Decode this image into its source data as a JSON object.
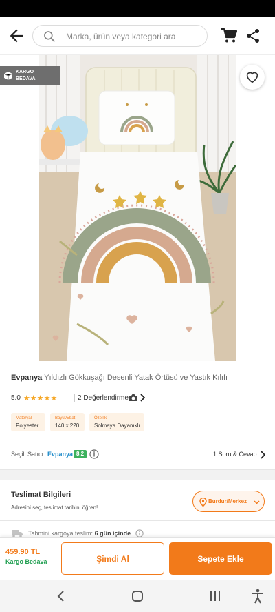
{
  "search": {
    "placeholder": "Marka, ürün veya kategori ara"
  },
  "gallery": {
    "badge_line1": "KARGO",
    "badge_line2": "BEDAVA"
  },
  "product": {
    "brand": "Evpanya",
    "name": "Yıldızlı Gökkuşağı Desenli Yatak Örtüsü ve Yastık Kılıfı",
    "rating": "5.0",
    "stars": "★★★★★",
    "reviews_label": "2 Değerlendirme",
    "attributes": [
      {
        "key": "Materyal",
        "value": "Polyester"
      },
      {
        "key": "Boyut/Ebat",
        "value": "140 x 220"
      },
      {
        "key": "Özellik",
        "value": "Solmaya Dayanıklı"
      }
    ]
  },
  "seller": {
    "label": "Seçili Satıcı:",
    "name": "Evpanya",
    "score": "8.2",
    "qa_label": "1 Soru & Cevap"
  },
  "delivery": {
    "title": "Teslimat Bilgileri",
    "subtitle": "Adresini seç, teslimat tarihini öğren!",
    "location": "Burdur/Merkez",
    "eta_label": "Tahmini kargoya teslim:",
    "eta_value": "6 gün içinde"
  },
  "purchase": {
    "price": "459.90 TL",
    "shipping": "Kargo Bedava",
    "buy_now": "Şimdi Al",
    "add_to_cart": "Sepete Ekle"
  },
  "colors": {
    "accent": "#f27a1a",
    "success": "#1f9e50",
    "seller_link": "#1d8ac9"
  },
  "icons": [
    "back-arrow-icon",
    "search-icon",
    "cart-icon",
    "share-icon",
    "box-icon",
    "heart-icon",
    "camera-icon",
    "chevron-right-icon",
    "info-icon",
    "location-pin-icon",
    "chevron-down-icon",
    "truck-icon",
    "nav-back-icon",
    "nav-home-icon",
    "nav-recent-icon",
    "accessibility-icon"
  ]
}
